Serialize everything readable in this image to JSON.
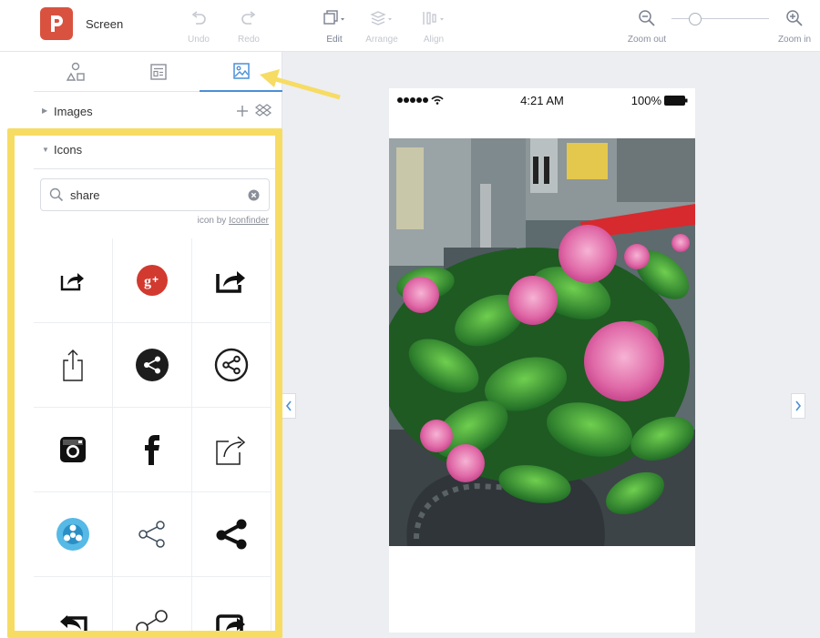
{
  "app": {
    "title": "Screen"
  },
  "toolbar": {
    "undo": "Undo",
    "redo": "Redo",
    "edit": "Edit",
    "arrange": "Arrange",
    "align": "Align",
    "zoom_out": "Zoom out",
    "zoom_in": "Zoom in"
  },
  "zoom": {
    "level_fraction": 0.2
  },
  "panel": {
    "tabs": [
      {
        "icon": "shapes-icon",
        "active": false
      },
      {
        "icon": "widgets-icon",
        "active": false
      },
      {
        "icon": "image-icon",
        "active": true
      }
    ],
    "images_label": "Images",
    "icons_label": "Icons",
    "search_value": "share",
    "credit_prefix": "icon by",
    "credit_link": "Iconfinder"
  },
  "icon_results": [
    "share-arrow-box-icon",
    "google-plus-icon",
    "share-arrow-box-bold-icon",
    "upload-share-icon",
    "share-circle-filled-icon",
    "share-circle-outline-icon",
    "instagram-icon",
    "facebook-icon",
    "share-external-icon",
    "share-network-round-icon",
    "share-nodes-thin-icon",
    "share-nodes-bold-icon",
    "reply-box-icon",
    "share-nodes-outline-icon",
    "share-box-rotate-icon"
  ],
  "phone": {
    "time": "4:21 AM",
    "battery": "100%"
  },
  "colors": {
    "brand": "#d9523f",
    "accent": "#4a8fd8",
    "highlight": "#f7dc63"
  }
}
